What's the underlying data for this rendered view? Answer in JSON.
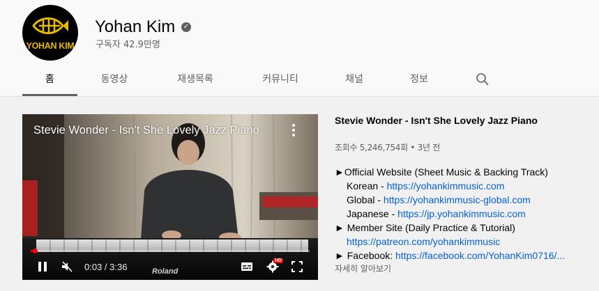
{
  "channel": {
    "name": "Yohan Kim",
    "logo_text": "YOHAN KIM",
    "subscribers": "구독자 42.9만명",
    "verified_glyph": "✓"
  },
  "tabs": [
    {
      "label": "홈",
      "active": true
    },
    {
      "label": "동영상"
    },
    {
      "label": "재생목록"
    },
    {
      "label": "커뮤니티"
    },
    {
      "label": "채널"
    },
    {
      "label": "정보"
    }
  ],
  "player": {
    "title": "Stevie Wonder - Isn't She Lovely Jazz Piano",
    "time": "0:03 / 3:36",
    "progress_fraction": 0.014,
    "hd_badge": "HD",
    "brand": "Roland"
  },
  "video": {
    "title": "Stevie Wonder - Isn't She Lovely Jazz Piano",
    "meta": "조회수 5,246,754회 • 3년 전",
    "desc": {
      "l1": "►Official Website (Sheet Music & Backing Track)",
      "korean_label": "Korean - ",
      "korean_link": "https://yohankimmusic.com",
      "global_label": "Global - ",
      "global_link": "https://yohankimmusic-global.com",
      "japanese_label": "Japanese - ",
      "japanese_link": "https://jp.yohankimmusic.com",
      "member_label": "► Member Site (Daily Practice & Tutorial)",
      "patreon_link": "https://patreon.com/yohankimmusic",
      "facebook_label": "► Facebook: ",
      "facebook_link": "https://facebook.com/YohanKim0716/..."
    },
    "more": "자세히 알아보기"
  },
  "colors": {
    "accent_link": "#065fd4",
    "progress": "#ff0000",
    "logo_gold": "#e6b800"
  }
}
